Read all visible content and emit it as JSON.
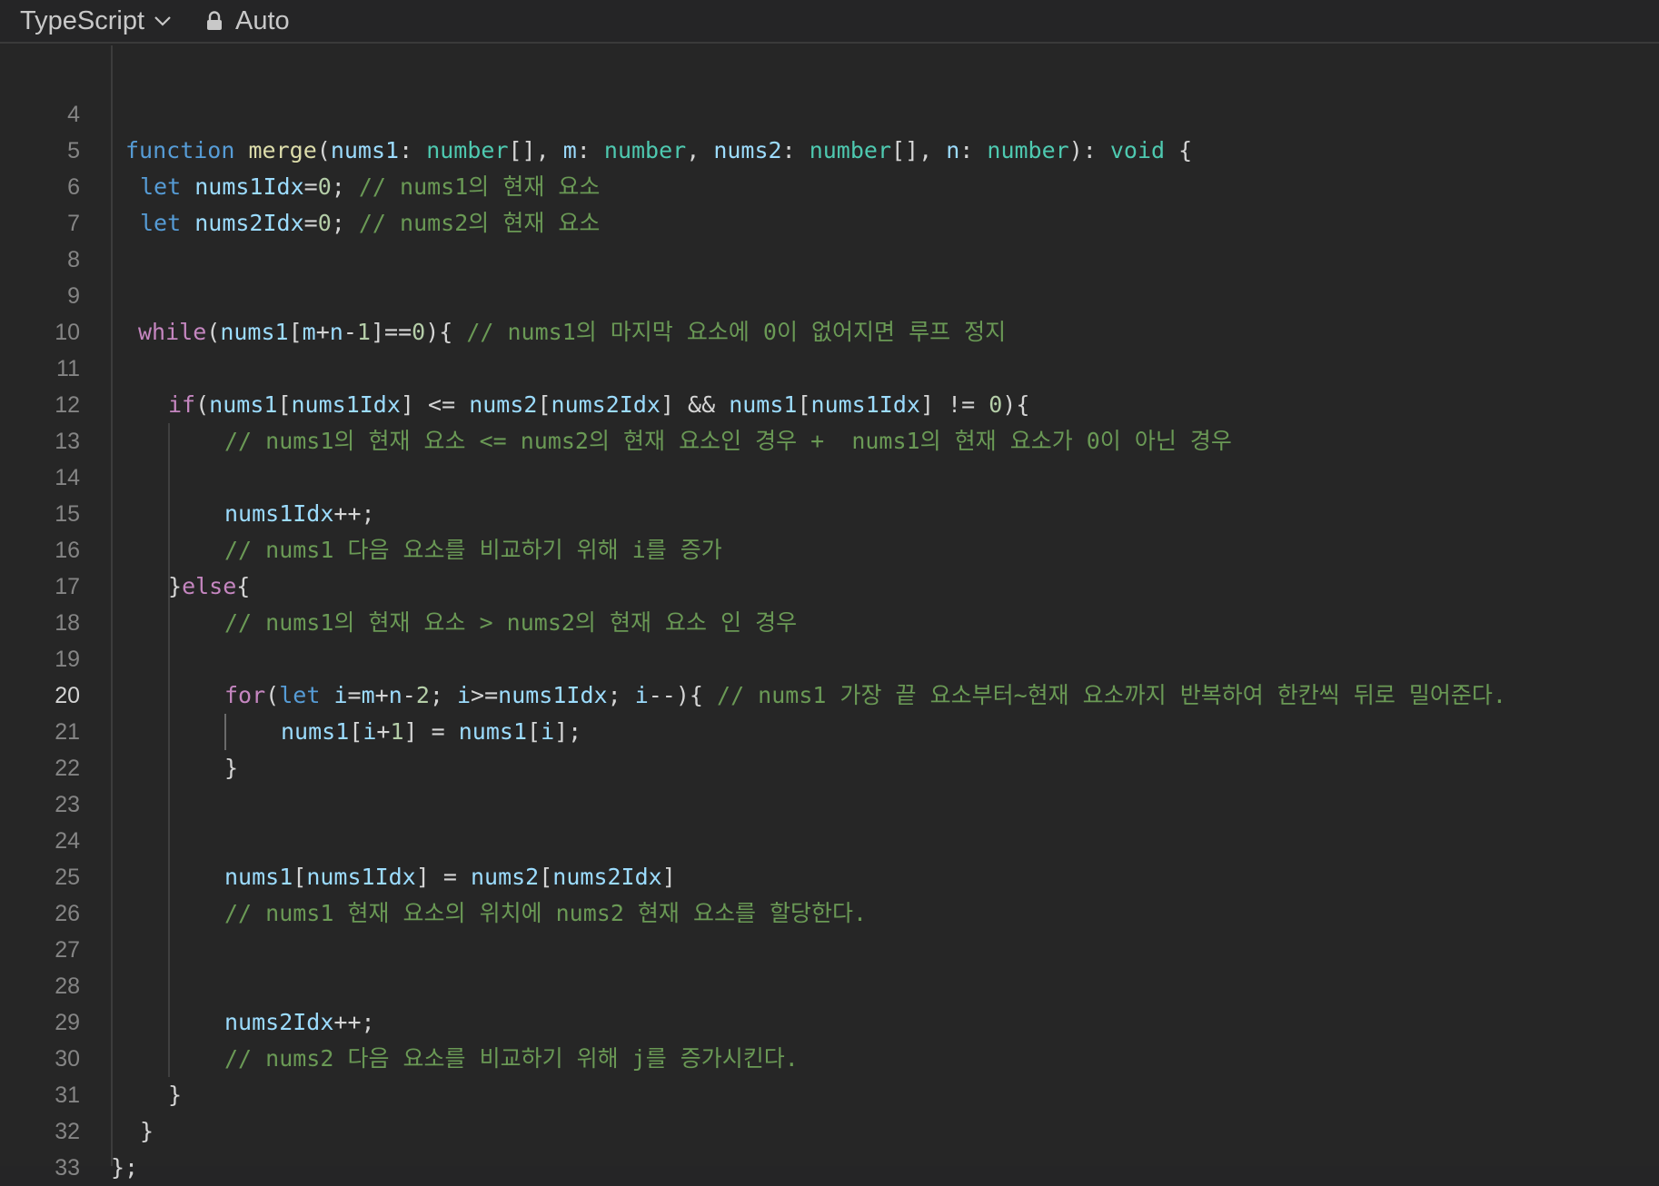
{
  "toolbar": {
    "language": "TypeScript",
    "mode": "Auto"
  },
  "editor": {
    "active_line": 20,
    "lines": [
      {
        "n": 4,
        "tokens": []
      },
      {
        "n": 5,
        "tokens": [
          [
            "function",
            "k-fn"
          ],
          [
            " ",
            "punc"
          ],
          [
            "merge",
            "fname"
          ],
          [
            "(",
            "punc"
          ],
          [
            "nums1",
            "var"
          ],
          [
            ": ",
            "punc"
          ],
          [
            "number",
            "type"
          ],
          [
            "[], ",
            "punc"
          ],
          [
            "m",
            "var"
          ],
          [
            ": ",
            "punc"
          ],
          [
            "number",
            "type"
          ],
          [
            ", ",
            "punc"
          ],
          [
            "nums2",
            "var"
          ],
          [
            ": ",
            "punc"
          ],
          [
            "number",
            "type"
          ],
          [
            "[], ",
            "punc"
          ],
          [
            "n",
            "var"
          ],
          [
            ": ",
            "punc"
          ],
          [
            "number",
            "type"
          ],
          [
            "): ",
            "punc"
          ],
          [
            "void",
            "type"
          ],
          [
            " {",
            "punc"
          ]
        ]
      },
      {
        "n": 6,
        "tokens": [
          [
            "let",
            "k-fn"
          ],
          [
            " ",
            "punc"
          ],
          [
            "nums1Idx",
            "var"
          ],
          [
            "=",
            "punc"
          ],
          [
            "0",
            "num"
          ],
          [
            "; ",
            "punc"
          ],
          [
            "// nums1의 현재 요소",
            "cmt"
          ]
        ]
      },
      {
        "n": 7,
        "tokens": [
          [
            "let",
            "k-fn"
          ],
          [
            " ",
            "punc"
          ],
          [
            "nums2Idx",
            "var"
          ],
          [
            "=",
            "punc"
          ],
          [
            "0",
            "num"
          ],
          [
            "; ",
            "punc"
          ],
          [
            "// nums2의 현재 요소",
            "cmt"
          ]
        ]
      },
      {
        "n": 8,
        "tokens": []
      },
      {
        "n": 9,
        "tokens": []
      },
      {
        "n": 10,
        "tokens": [
          [
            "while",
            "k-ctl"
          ],
          [
            "(",
            "punc"
          ],
          [
            "nums1",
            "var"
          ],
          [
            "[",
            "punc"
          ],
          [
            "m",
            "var"
          ],
          [
            "+",
            "punc"
          ],
          [
            "n",
            "var"
          ],
          [
            "-",
            "punc"
          ],
          [
            "1",
            "num"
          ],
          [
            "]==",
            "punc"
          ],
          [
            "0",
            "num"
          ],
          [
            "){ ",
            "punc"
          ],
          [
            "// nums1의 마지막 요소에 0이 없어지면 루프 정지",
            "cmt"
          ]
        ]
      },
      {
        "n": 11,
        "tokens": []
      },
      {
        "n": 12,
        "tokens": [
          [
            "if",
            "k-ctl"
          ],
          [
            "(",
            "punc"
          ],
          [
            "nums1",
            "var"
          ],
          [
            "[",
            "punc"
          ],
          [
            "nums1Idx",
            "var"
          ],
          [
            "] <= ",
            "punc"
          ],
          [
            "nums2",
            "var"
          ],
          [
            "[",
            "punc"
          ],
          [
            "nums2Idx",
            "var"
          ],
          [
            "] && ",
            "punc"
          ],
          [
            "nums1",
            "var"
          ],
          [
            "[",
            "punc"
          ],
          [
            "nums1Idx",
            "var"
          ],
          [
            "] != ",
            "punc"
          ],
          [
            "0",
            "num"
          ],
          [
            "){",
            "punc"
          ]
        ]
      },
      {
        "n": 13,
        "tokens": [
          [
            "// nums1의 현재 요소 <= nums2의 현재 요소인 경우 +  nums1의 현재 요소가 0이 아닌 경우",
            "cmt"
          ]
        ]
      },
      {
        "n": 14,
        "tokens": []
      },
      {
        "n": 15,
        "tokens": [
          [
            "nums1Idx",
            "var"
          ],
          [
            "++;",
            "punc"
          ]
        ]
      },
      {
        "n": 16,
        "tokens": [
          [
            "// nums1 다음 요소를 비교하기 위해 i를 증가",
            "cmt"
          ]
        ]
      },
      {
        "n": 17,
        "tokens": [
          [
            "}",
            "punc"
          ],
          [
            "else",
            "k-ctl"
          ],
          [
            "{",
            "punc"
          ]
        ]
      },
      {
        "n": 18,
        "tokens": [
          [
            "// nums1의 현재 요소 > nums2의 현재 요소 인 경우",
            "cmt"
          ]
        ]
      },
      {
        "n": 19,
        "tokens": []
      },
      {
        "n": 20,
        "tokens": [
          [
            "for",
            "k-ctl"
          ],
          [
            "(",
            "punc"
          ],
          [
            "let",
            "k-fn"
          ],
          [
            " ",
            "punc"
          ],
          [
            "i",
            "var"
          ],
          [
            "=",
            "punc"
          ],
          [
            "m",
            "var"
          ],
          [
            "+",
            "punc"
          ],
          [
            "n",
            "var"
          ],
          [
            "-",
            "punc"
          ],
          [
            "2",
            "num"
          ],
          [
            "; ",
            "punc"
          ],
          [
            "i",
            "var"
          ],
          [
            ">=",
            "punc"
          ],
          [
            "nums1Idx",
            "var"
          ],
          [
            "; ",
            "punc"
          ],
          [
            "i",
            "var"
          ],
          [
            "--){ ",
            "punc"
          ],
          [
            "// nums1 가장 끝 요소부터~현재 요소까지 반복하여 한칸씩 뒤로 밀어준다.",
            "cmt"
          ]
        ]
      },
      {
        "n": 21,
        "tokens": [
          [
            "nums1",
            "var"
          ],
          [
            "[",
            "punc"
          ],
          [
            "i",
            "var"
          ],
          [
            "+",
            "punc"
          ],
          [
            "1",
            "num"
          ],
          [
            "] = ",
            "punc"
          ],
          [
            "nums1",
            "var"
          ],
          [
            "[",
            "punc"
          ],
          [
            "i",
            "var"
          ],
          [
            "];",
            "punc"
          ]
        ]
      },
      {
        "n": 22,
        "tokens": [
          [
            "}",
            "punc"
          ]
        ]
      },
      {
        "n": 23,
        "tokens": []
      },
      {
        "n": 24,
        "tokens": []
      },
      {
        "n": 25,
        "tokens": [
          [
            "nums1",
            "var"
          ],
          [
            "[",
            "punc"
          ],
          [
            "nums1Idx",
            "var"
          ],
          [
            "] = ",
            "punc"
          ],
          [
            "nums2",
            "var"
          ],
          [
            "[",
            "punc"
          ],
          [
            "nums2Idx",
            "var"
          ],
          [
            "]",
            "punc"
          ]
        ]
      },
      {
        "n": 26,
        "tokens": [
          [
            "// nums1 현재 요소의 위치에 nums2 현재 요소를 할당한다.",
            "cmt"
          ]
        ]
      },
      {
        "n": 27,
        "tokens": []
      },
      {
        "n": 28,
        "tokens": []
      },
      {
        "n": 29,
        "tokens": [
          [
            "nums2Idx",
            "var"
          ],
          [
            "++;",
            "punc"
          ]
        ]
      },
      {
        "n": 30,
        "tokens": [
          [
            "// nums2 다음 요소를 비교하기 위해 j를 증가시킨다.",
            "cmt"
          ]
        ]
      },
      {
        "n": 31,
        "tokens": [
          [
            "}",
            "punc"
          ]
        ]
      },
      {
        "n": 32,
        "tokens": [
          [
            "}",
            "punc"
          ]
        ]
      },
      {
        "n": 33,
        "tokens": [
          [
            "};",
            "punc"
          ]
        ]
      }
    ]
  }
}
